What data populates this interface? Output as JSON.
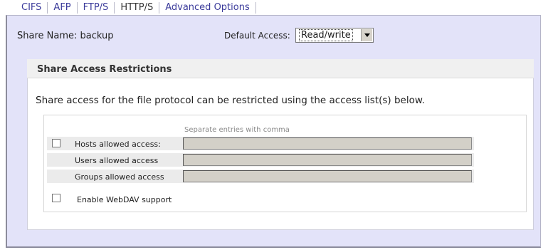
{
  "tabs": [
    {
      "label": "CIFS"
    },
    {
      "label": "AFP"
    },
    {
      "label": "FTP/S"
    },
    {
      "label": "HTTP/S",
      "active": true
    },
    {
      "label": "Advanced Options"
    }
  ],
  "share": {
    "name_label": "Share Name: backup",
    "default_access_label": "Default Access:",
    "default_access_value": "Read/write"
  },
  "restrictions": {
    "title": "Share Access Restrictions",
    "description": "Share access for the file protocol can be restricted using the access list(s) below.",
    "hint": "Separate entries with comma",
    "fields": [
      {
        "label": "Hosts allowed access:",
        "value": "",
        "checked": false
      },
      {
        "label": "Users allowed access",
        "value": ""
      },
      {
        "label": "Groups allowed access",
        "value": ""
      }
    ],
    "webdav_label": "Enable WebDAV support",
    "webdav_checked": false
  },
  "colors": {
    "frame_bg": "#e3e3f9",
    "tab_text": "#3a3a9a",
    "field_bg": "#d3d0c8"
  },
  "icons": {
    "select_arrow": "chevron-down-icon"
  }
}
